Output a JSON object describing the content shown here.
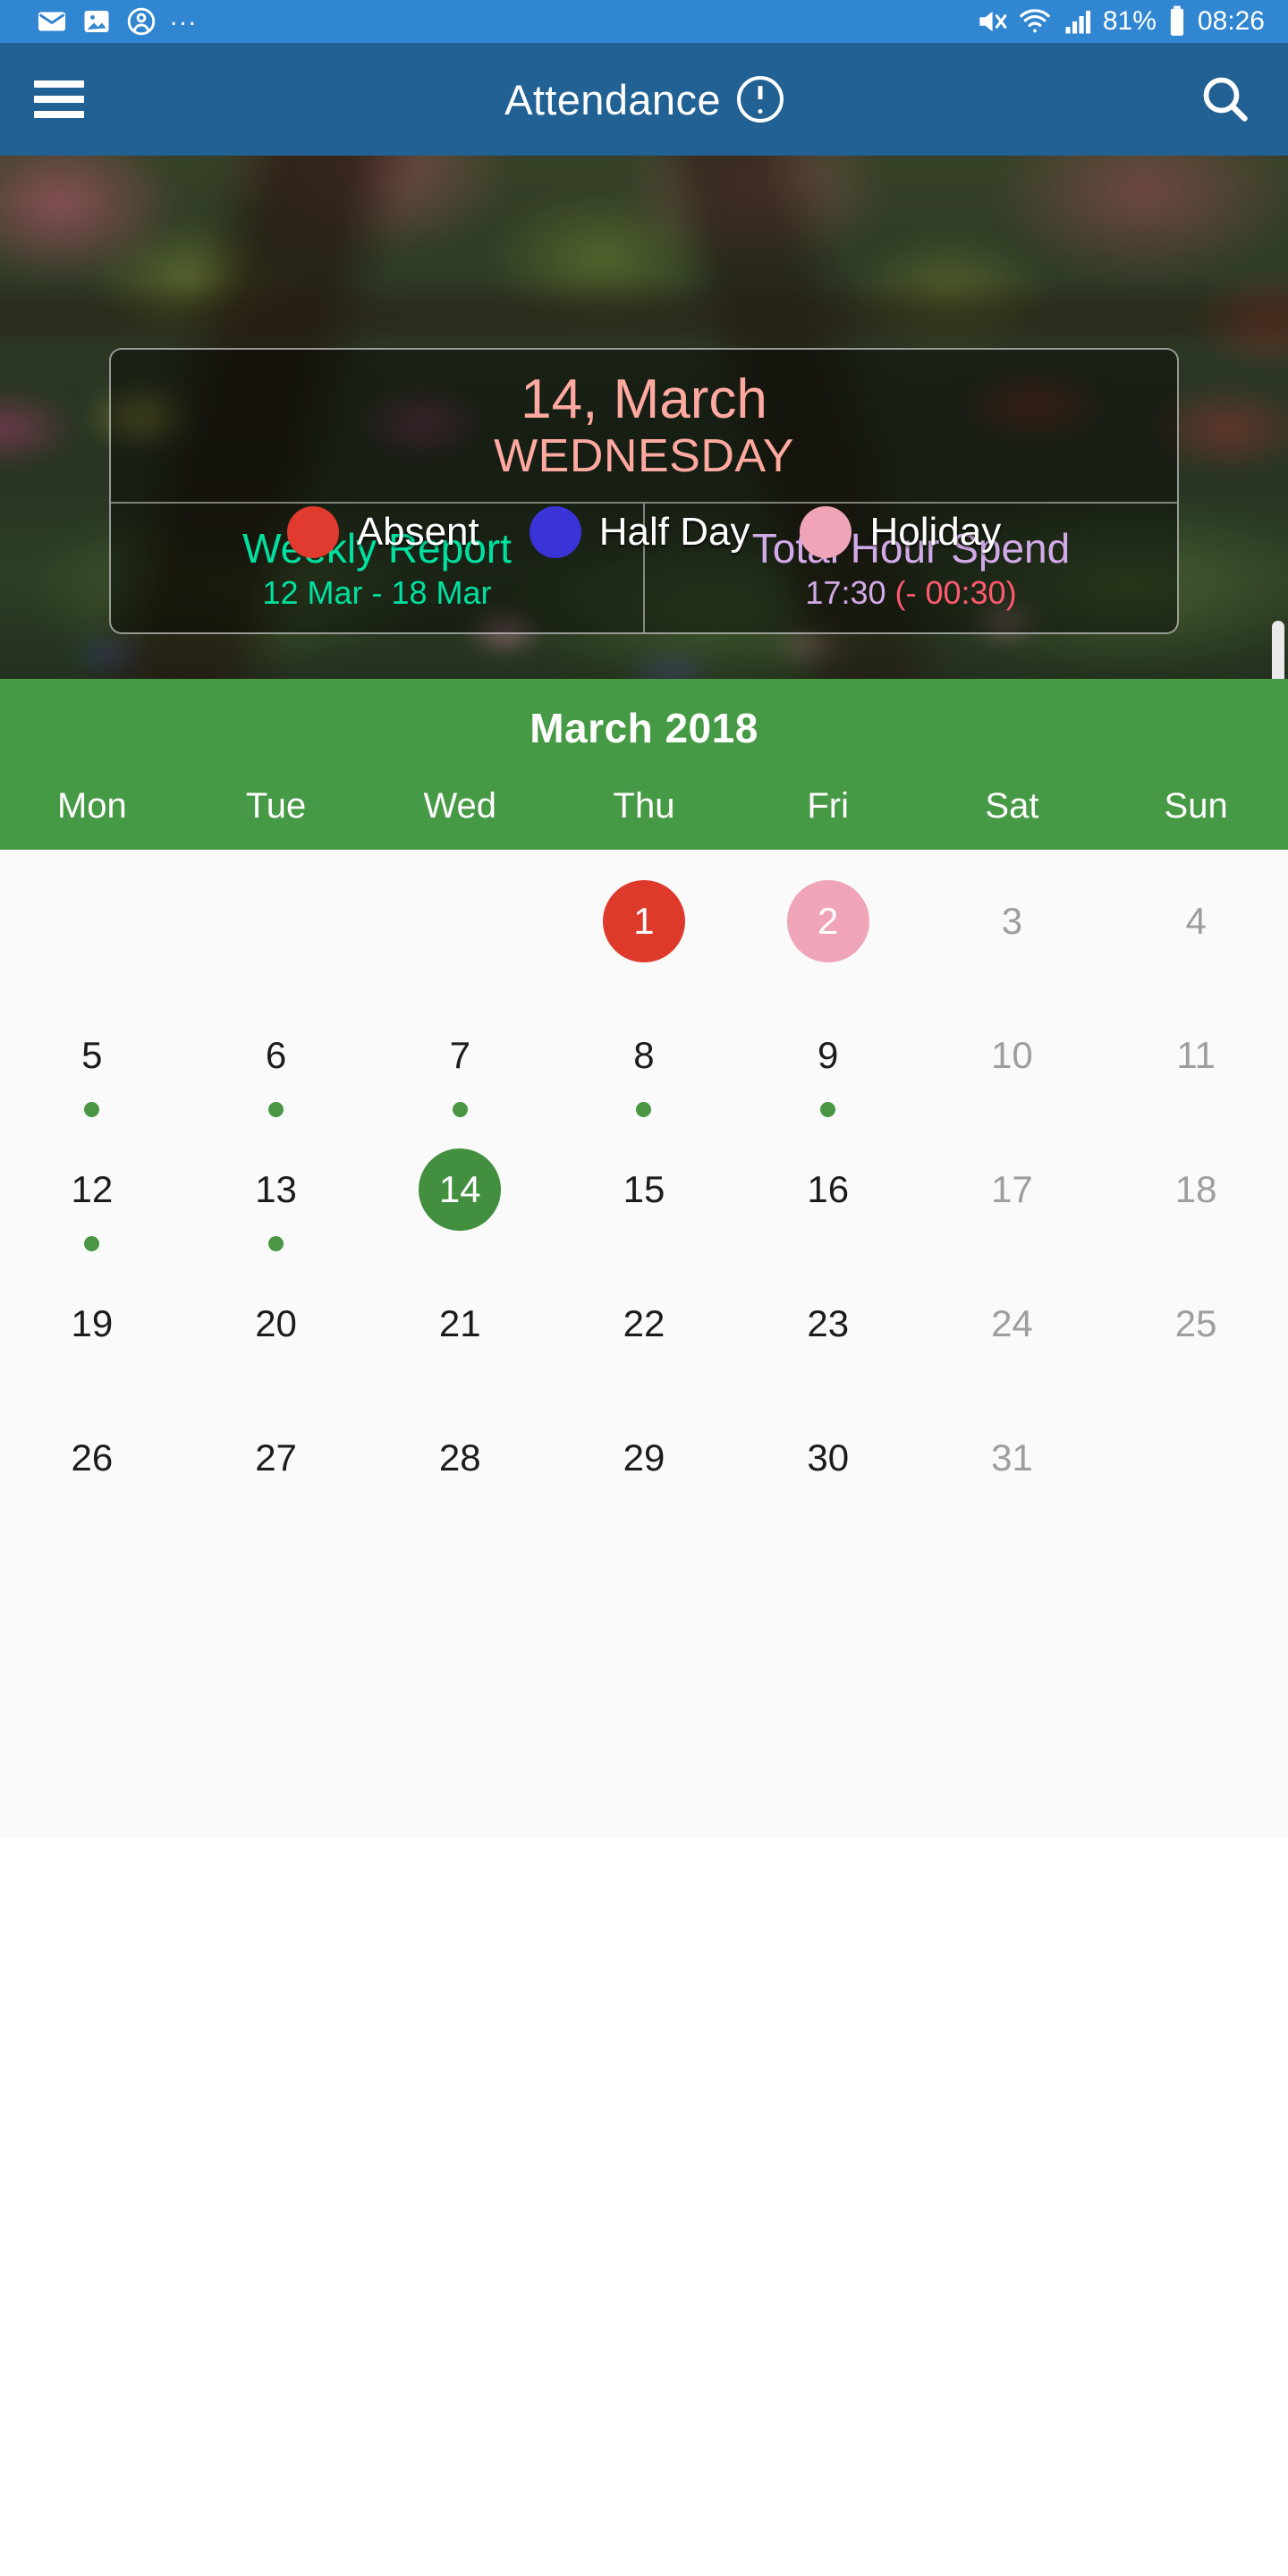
{
  "status_bar": {
    "left_icons": [
      "email-icon",
      "image-icon",
      "contact-icon",
      "overflow-dots"
    ],
    "overflow": "...",
    "right_icons": [
      "mute-icon",
      "wifi-icon",
      "signal-icon",
      "battery-icon"
    ],
    "battery_percent": "81%",
    "time": "08:26",
    "background": "#3086d0"
  },
  "app_bar": {
    "menu_icon": "hamburger-icon",
    "title": "Attendance",
    "info_icon": "exclamation-circle-icon",
    "search_icon": "search-icon",
    "background": "#216193"
  },
  "hero": {
    "summary_card": {
      "date": "14, March",
      "weekday": "WEDNESDAY",
      "date_color": "#ffa9a0",
      "left_cell": {
        "title": "Weekly Report",
        "subtitle": "12 Mar - 18 Mar",
        "color": "#00e0a0"
      },
      "right_cell": {
        "title": "Total Hour Spend",
        "hours": "17:30",
        "delta": "(- 00:30)",
        "color": "#d2aae9",
        "delta_color": "#ff5a6e"
      }
    },
    "legend": [
      {
        "label": "Absent",
        "color": "#e03b2e"
      },
      {
        "label": "Half Day",
        "color": "#3a33d8"
      },
      {
        "label": "Holiday",
        "color": "#f0a4b8"
      }
    ]
  },
  "calendar": {
    "month_label": "March 2018",
    "header_color": "#479a45",
    "weekday_labels": [
      "Mon",
      "Tue",
      "Wed",
      "Thu",
      "Fri",
      "Sat",
      "Sun"
    ],
    "weeks": [
      [
        {
          "day": "",
          "state": "empty",
          "marker": false
        },
        {
          "day": "",
          "state": "empty",
          "marker": false
        },
        {
          "day": "",
          "state": "empty",
          "marker": false
        },
        {
          "day": "1",
          "state": "absent",
          "marker": false
        },
        {
          "day": "2",
          "state": "holiday",
          "marker": false
        },
        {
          "day": "3",
          "state": "weekend",
          "marker": false
        },
        {
          "day": "4",
          "state": "weekend",
          "marker": false
        }
      ],
      [
        {
          "day": "5",
          "state": "normal",
          "marker": true
        },
        {
          "day": "6",
          "state": "normal",
          "marker": true
        },
        {
          "day": "7",
          "state": "normal",
          "marker": true
        },
        {
          "day": "8",
          "state": "normal",
          "marker": true
        },
        {
          "day": "9",
          "state": "normal",
          "marker": true
        },
        {
          "day": "10",
          "state": "weekend",
          "marker": false
        },
        {
          "day": "11",
          "state": "weekend",
          "marker": false
        }
      ],
      [
        {
          "day": "12",
          "state": "normal",
          "marker": true
        },
        {
          "day": "13",
          "state": "normal",
          "marker": true
        },
        {
          "day": "14",
          "state": "selected",
          "marker": false
        },
        {
          "day": "15",
          "state": "normal",
          "marker": false
        },
        {
          "day": "16",
          "state": "normal",
          "marker": false
        },
        {
          "day": "17",
          "state": "weekend",
          "marker": false
        },
        {
          "day": "18",
          "state": "weekend",
          "marker": false
        }
      ],
      [
        {
          "day": "19",
          "state": "normal",
          "marker": false
        },
        {
          "day": "20",
          "state": "normal",
          "marker": false
        },
        {
          "day": "21",
          "state": "normal",
          "marker": false
        },
        {
          "day": "22",
          "state": "normal",
          "marker": false
        },
        {
          "day": "23",
          "state": "normal",
          "marker": false
        },
        {
          "day": "24",
          "state": "weekend",
          "marker": false
        },
        {
          "day": "25",
          "state": "weekend",
          "marker": false
        }
      ],
      [
        {
          "day": "26",
          "state": "normal",
          "marker": false
        },
        {
          "day": "27",
          "state": "normal",
          "marker": false
        },
        {
          "day": "28",
          "state": "normal",
          "marker": false
        },
        {
          "day": "29",
          "state": "normal",
          "marker": false
        },
        {
          "day": "30",
          "state": "normal",
          "marker": false
        },
        {
          "day": "31",
          "state": "weekend",
          "marker": false
        },
        {
          "day": "",
          "state": "empty",
          "marker": false
        }
      ]
    ]
  }
}
